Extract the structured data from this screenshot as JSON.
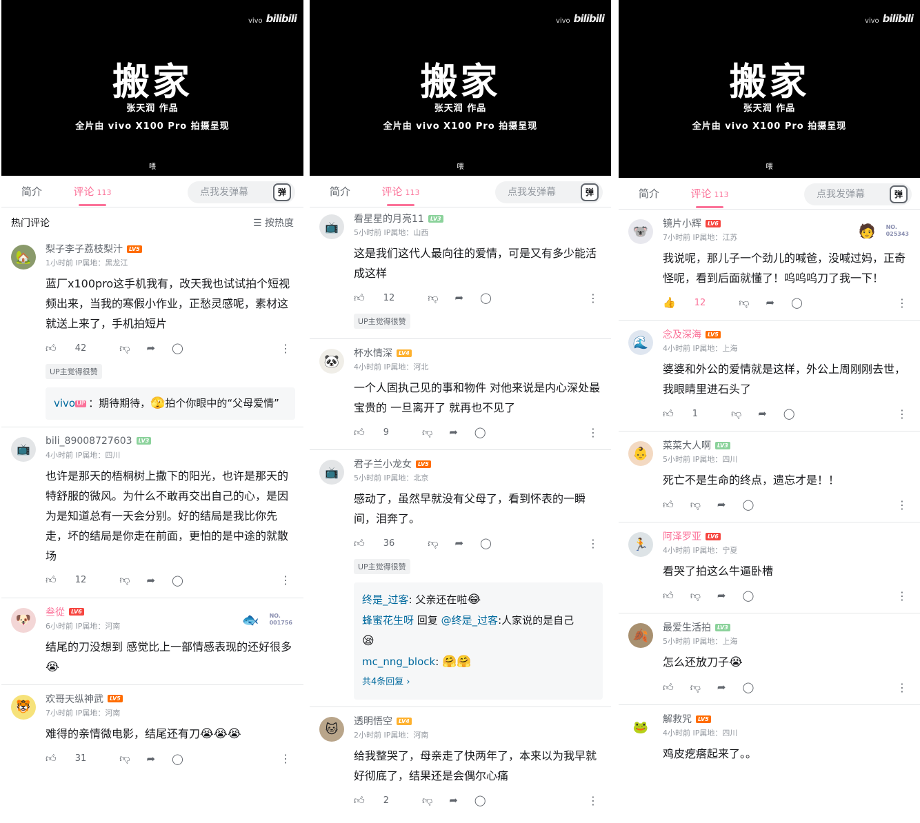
{
  "video": {
    "brand_small": "vivo",
    "brand_main": "bilibili",
    "title": "搬家",
    "author": "张天润 作品",
    "credit": "全片由 vivo X100 Pro 拍摄呈现",
    "subtitle": "喂"
  },
  "tabs": {
    "intro": "简介",
    "comments": "评论",
    "count": "113",
    "danmaku_placeholder": "点我发弹幕",
    "danmaku_icon": "弹"
  },
  "hot": {
    "title": "热门评论",
    "sort": "按热度"
  },
  "icons": {
    "like": "thumbs-up-icon",
    "dislike": "thumbs-down-icon",
    "share": "share-icon",
    "reply": "chat-bubble-icon",
    "more": "more-vertical-icon"
  },
  "panel1": {
    "c1": {
      "name": "梨子李子荔枝梨汁",
      "level": "LV5",
      "time": "1小时前",
      "ip": "IP属地：黑龙江",
      "text": "蓝厂x100pro这手机我有，改天我也试试拍个短视频出来，当我的寒假小作业，正愁灵感呢，素材这就送上来了，手机拍短片",
      "likes": "42",
      "badge": "UP主觉得很赞",
      "reply_name": "vivo",
      "reply_up": "UP",
      "reply_text": "：期待期待，",
      "reply_text2": "拍个你眼中的“父母爱情”"
    },
    "c2": {
      "name": "bili_89008727603",
      "level": "LV3",
      "time": "4小时前",
      "ip": "IP属地：四川",
      "text": "也许是那天的梧桐树上撒下的阳光，也许是那天的特舒服的微风。为什么不敢再交出自己的心，是因为是知道总有一天会分别。好的结局是我比你先走，坏的结局是你走在前面，更怕的是中途的就散场",
      "likes": "12"
    },
    "c3": {
      "name": "叁從",
      "level": "LV6",
      "time": "6小时前",
      "ip": "IP属地：河南",
      "text": "结尾的刀没想到 感觉比上一部情感表现的还好很多",
      "fan_no": "NO.",
      "fan_num": "001756"
    },
    "c4": {
      "name": "欢哥天纵神武",
      "level": "LV5",
      "time": "7小时前",
      "ip": "IP属地：河南",
      "text": "难得的亲情微电影，结尾还有刀",
      "likes": "31"
    }
  },
  "panel2": {
    "c1": {
      "name": "看星星的月亮11",
      "level": "LV3",
      "time": "5小时前",
      "ip": "IP属地：山西",
      "text": "这是我们这代人最向往的爱情，可是又有多少能活成这样",
      "likes": "12",
      "badge": "UP主觉得很赞"
    },
    "c2": {
      "name": "杯水情深",
      "level": "LV4",
      "time": "4小时前",
      "ip": "IP属地：河北",
      "text": "一个人固执己见的事和物件 对他来说是内心深处最宝贵的 一旦离开了 就再也不见了",
      "likes": "9"
    },
    "c3": {
      "name": "君子兰小龙女",
      "level": "LV5",
      "time": "5小时前",
      "ip": "IP属地：北京",
      "text": "感动了，虽然早就没有父母了，看到怀表的一瞬间，泪奔了。",
      "likes": "36",
      "badge": "UP主觉得很赞",
      "r1_name": "终是_过客",
      "r1_text": ": 父亲还在啦",
      "r2_name": "蜂蜜花生呀",
      "r2_mid": "回复",
      "r2_at": "@终是_过客",
      "r2_text": ":人家说的是自己",
      "r3_name": "mc_nng_block",
      "r3_text": ":",
      "total": "共4条回复 ›"
    },
    "c4": {
      "name": "透明悟空",
      "level": "LV4",
      "time": "2小时前",
      "ip": "IP属地：河南",
      "text": "给我整哭了，母亲走了快两年了，本来以为我早就好彻底了，结果还是会偶尔心痛",
      "likes": "2"
    }
  },
  "panel3": {
    "c1": {
      "name": "镜片小辉",
      "level": "LV6",
      "time": "7小时前",
      "ip": "IP属地：江苏",
      "text": "我说呢，那儿子一个劲儿的喊爸，没喊过妈，正奇怪呢，看到后面就懂了！呜呜呜刀了我一下！",
      "likes": "12",
      "fan_no": "NO.",
      "fan_num": "025343"
    },
    "c2": {
      "name": "念及深海",
      "level": "LV5",
      "time": "4小时前",
      "ip": "IP属地：上海",
      "text": "婆婆和外公的爱情就是这样，外公上周刚刚去世，我眼睛里进石头了",
      "likes": "1"
    },
    "c3": {
      "name": "菜菜大人啊",
      "level": "LV3",
      "time": "5小时前",
      "ip": "IP属地：四川",
      "text": "死亡不是生命的终点，遗忘才是！！"
    },
    "c4": {
      "name": "阿泽罗亚",
      "level": "LV6",
      "time": "4小时前",
      "ip": "IP属地：宁夏",
      "text": "看哭了拍这么牛逼卧槽"
    },
    "c5": {
      "name": "最爱生活拍",
      "level": "LV3",
      "time": "5小时前",
      "ip": "IP属地：上海",
      "text": "怎么还放刀子"
    },
    "c6": {
      "name": "解救咒",
      "level": "LV5",
      "time": "4小时前",
      "ip": "IP属地：四川",
      "text": "鸡皮疙瘩起来了。。"
    }
  }
}
